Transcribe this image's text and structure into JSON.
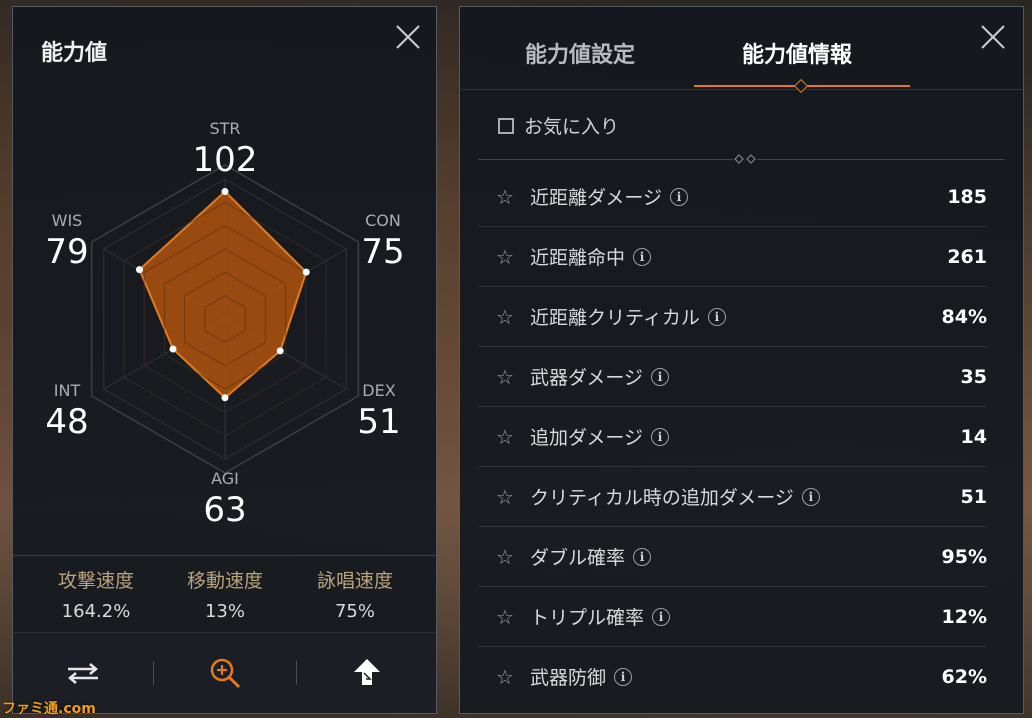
{
  "left_panel": {
    "title": "能力値",
    "stats": [
      {
        "key": "STR",
        "label": "STR",
        "value": 102
      },
      {
        "key": "CON",
        "label": "CON",
        "value": 75
      },
      {
        "key": "DEX",
        "label": "DEX",
        "value": 51
      },
      {
        "key": "AGI",
        "label": "AGI",
        "value": 63
      },
      {
        "key": "INT",
        "label": "INT",
        "value": 48
      },
      {
        "key": "WIS",
        "label": "WIS",
        "value": 79
      }
    ],
    "speeds": [
      {
        "label": "攻撃速度",
        "value": "164.2%"
      },
      {
        "label": "移動速度",
        "value": "13%"
      },
      {
        "label": "詠唱速度",
        "value": "75%"
      }
    ],
    "footer_icons": [
      "swap-icon",
      "zoom-in-icon",
      "level-up-arrow-icon"
    ]
  },
  "right_panel": {
    "tabs": [
      "能力値設定",
      "能力値情報"
    ],
    "active_tab": "能力値情報",
    "favorites_label": "お気に入り",
    "rows": [
      {
        "label": "近距離ダメージ",
        "value": "185"
      },
      {
        "label": "近距離命中",
        "value": "261"
      },
      {
        "label": "近距離クリティカル",
        "value": "84%"
      },
      {
        "label": "武器ダメージ",
        "value": "35"
      },
      {
        "label": "追加ダメージ",
        "value": "14"
      },
      {
        "label": "クリティカル時の追加ダメージ",
        "value": "51"
      },
      {
        "label": "ダブル確率",
        "value": "95%"
      },
      {
        "label": "トリプル確率",
        "value": "12%"
      },
      {
        "label": "武器防御",
        "value": "62%"
      }
    ]
  },
  "colors": {
    "accent": "#e07b1f",
    "radar_fill": "#b0530f",
    "panel_bg": "#161a1f"
  },
  "watermark": "ファミ通.com"
}
